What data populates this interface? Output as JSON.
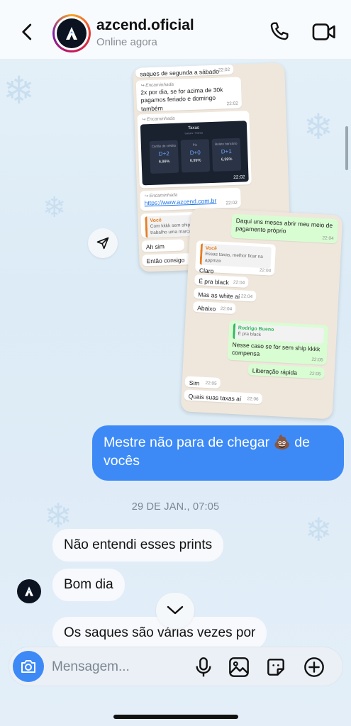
{
  "header": {
    "name": "azcend.oficial",
    "status": "Online agora"
  },
  "shot1": {
    "top_text": "saques de segunda a sábado",
    "top_time": "22:02",
    "fwd1_label": "Encaminhada",
    "fwd1_text": "2x por dia, se for acima de 30k pagamos feriado e domingo também",
    "fwd1_time": "22:02",
    "fwd2_label": "Encaminhada",
    "panel_title": "Taxas",
    "panel_sub": "Saques • Diárias",
    "boxes": [
      {
        "label": "Cartão de crédito",
        "value": "D+2",
        "pct": "6,99%"
      },
      {
        "label": "Pix",
        "value": "D+0",
        "pct": "6,99%"
      },
      {
        "label": "Boleto bancário",
        "value": "D+1",
        "pct": "6,99%"
      }
    ],
    "panel_time": "22:02",
    "fwd3_label": "Encaminhada",
    "link": "https://www.azcend.com.br",
    "link_time": "22:02",
    "quote_name": "Você",
    "quote_text": "Com kkkk sem ship n trabalho uma marca",
    "msg_ahsim": "Ah sim",
    "msg_entao": "Então consigo"
  },
  "shot2": {
    "out1": "Daqui uns meses abrir meu meio de pagamento próprio",
    "out1_time": "22:04",
    "quote_name": "Você",
    "quote_text": "Essas taxas, melhor ficar na appmax",
    "claro": "Claro",
    "claro_time": "22:04",
    "black": "É pra black",
    "black_time": "22:04",
    "white": "Mas as white aí",
    "white_time": "22:04",
    "abaixo": "Abaixo",
    "abaixo_time": "22:04",
    "q2_name": "Rodrigo Bueno",
    "q2_text": "É pra black",
    "nesse": "Nesse caso se for sem ship kkkk compensa",
    "nesse_time": "22:05",
    "liberacao": "Liberação rápida",
    "liberacao_time": "22:05",
    "sim": "Sim",
    "sim_time": "22:05",
    "quais": "Quais suas taxas aí",
    "quais_time": "22:06"
  },
  "messages": {
    "outgoing": "Mestre não para de chegar 💩 de vocês",
    "date_separator": "29 DE JAN., 07:05",
    "incoming": [
      "Não entendi esses prints",
      "Bom dia",
      "Os saques são várias vezes por"
    ]
  },
  "composer": {
    "placeholder": "Mensagem..."
  },
  "colors": {
    "accent": "#3d8af7",
    "background": "#e3eef8"
  }
}
